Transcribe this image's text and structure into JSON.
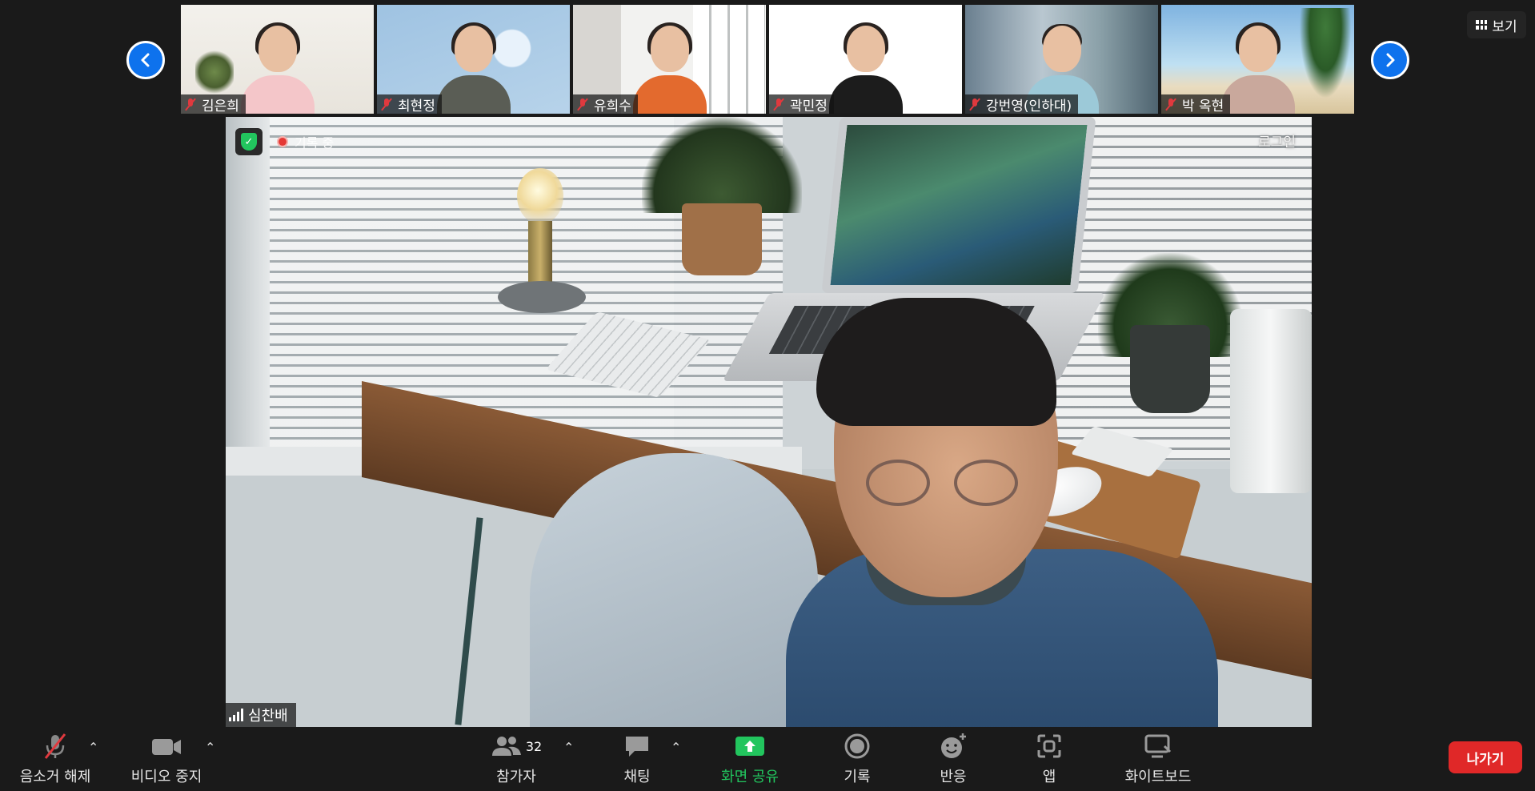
{
  "participants_strip": [
    {
      "name": "김은희",
      "muted": true
    },
    {
      "name": "최현정",
      "muted": true
    },
    {
      "name": "유희수",
      "muted": true
    },
    {
      "name": "곽민정",
      "muted": true
    },
    {
      "name": "강번영(인하대)",
      "muted": true
    },
    {
      "name": "박 옥현",
      "muted": true
    }
  ],
  "view_button": {
    "label": "보기",
    "icon": "grid-icon"
  },
  "main_video": {
    "recording_label": "기록 중",
    "login_label": "로그인",
    "speaker_name": "심찬배"
  },
  "toolbar": {
    "unmute_label": "음소거 해제",
    "video_label": "비디오 중지",
    "participants_label": "참가자",
    "participants_count": "32",
    "chat_label": "채팅",
    "share_label": "화면 공유",
    "record_label": "기록",
    "reactions_label": "반응",
    "apps_label": "앱",
    "whiteboard_label": "화이트보드",
    "leave_label": "나가기"
  },
  "colors": {
    "background": "#1a1a1a",
    "accent_blue": "#0e72ed",
    "share_green": "#22c55e",
    "leave_red": "#e02828",
    "muted_red": "#e0393e"
  }
}
